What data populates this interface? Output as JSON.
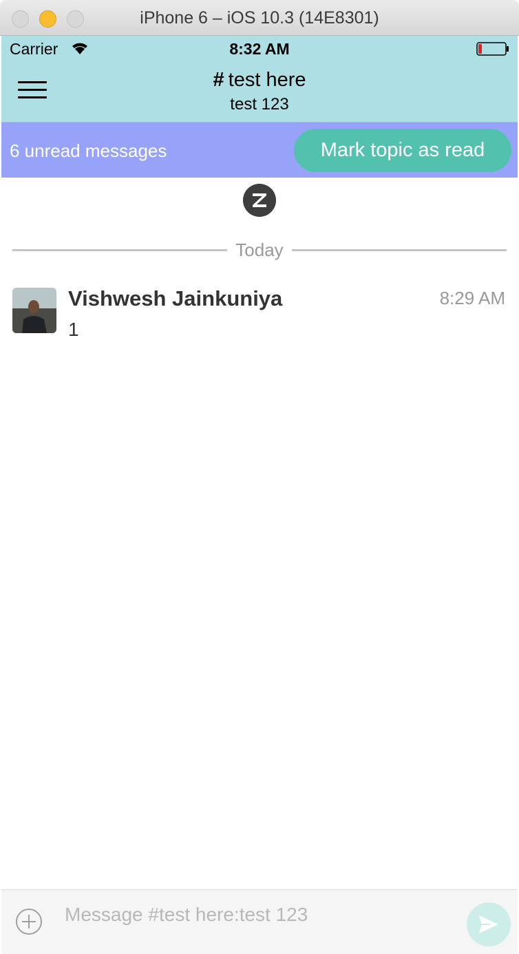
{
  "window": {
    "title": "iPhone 6 – iOS 10.3 (14E8301)"
  },
  "status_bar": {
    "carrier": "Carrier",
    "time": "8:32 AM",
    "icons": [
      "wifi-icon",
      "battery-icon"
    ]
  },
  "header": {
    "stream_hash": "#",
    "stream_name": "test here",
    "topic": "test 123",
    "menu_icon": "hamburger-menu-icon"
  },
  "unread_banner": {
    "text": "6 unread messages",
    "button_label": "Mark topic as read"
  },
  "date_divider": {
    "label": "Today"
  },
  "messages": [
    {
      "sender": "Vishwesh Jainkuniya",
      "time": "8:29 AM",
      "content": "1"
    }
  ],
  "compose": {
    "placeholder": "Message #test here:test 123",
    "add_icon": "plus-circle-icon",
    "send_icon": "send-icon"
  },
  "colors": {
    "header_bg": "#aedfe4",
    "unread_bar_bg": "#96a3f8",
    "button_bg": "#52c2af",
    "send_button_bg": "#cdeee8"
  }
}
